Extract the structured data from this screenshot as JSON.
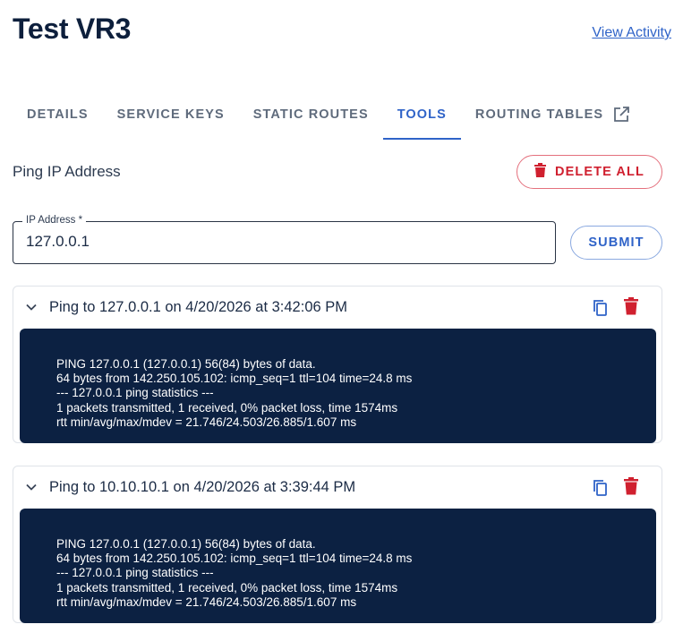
{
  "header": {
    "title": "Test VR3",
    "view_activity": "View Activity"
  },
  "tabs": [
    {
      "label": "DETAILS",
      "active": false
    },
    {
      "label": "SERVICE KEYS",
      "active": false
    },
    {
      "label": "STATIC ROUTES",
      "active": false
    },
    {
      "label": "TOOLS",
      "active": true
    },
    {
      "label": "ROUTING TABLES",
      "active": false,
      "icon": "external-link-icon"
    }
  ],
  "ping": {
    "section_title": "Ping IP Address",
    "delete_all_label": "DELETE ALL",
    "ip_label": "IP Address *",
    "ip_value": "127.0.0.1",
    "submit_label": "SUBMIT"
  },
  "results": [
    {
      "title": "Ping to 127.0.0.1 on 4/20/2026 at 3:42:06 PM",
      "lines": [
        "PING 127.0.0.1 (127.0.0.1) 56(84) bytes of data.",
        "64 bytes from 142.250.105.102: icmp_seq=1 ttl=104 time=24.8 ms",
        "--- 127.0.0.1 ping statistics ---",
        "1 packets transmitted, 1 received, 0% packet loss, time 1574ms",
        "rtt min/avg/max/mdev = 21.746/24.503/26.885/1.607 ms"
      ]
    },
    {
      "title": "Ping to 10.10.10.1 on 4/20/2026 at 3:39:44 PM",
      "lines": [
        "PING 127.0.0.1 (127.0.0.1) 56(84) bytes of data.",
        "64 bytes from 142.250.105.102: icmp_seq=1 ttl=104 time=24.8 ms",
        "--- 127.0.0.1 ping statistics ---",
        "1 packets transmitted, 1 received, 0% packet loss, time 1574ms",
        "rtt min/avg/max/mdev = 21.746/24.503/26.885/1.607 ms"
      ]
    }
  ],
  "colors": {
    "accent": "#2f63c8",
    "danger": "#d0202f",
    "console_bg": "#0c2142"
  }
}
